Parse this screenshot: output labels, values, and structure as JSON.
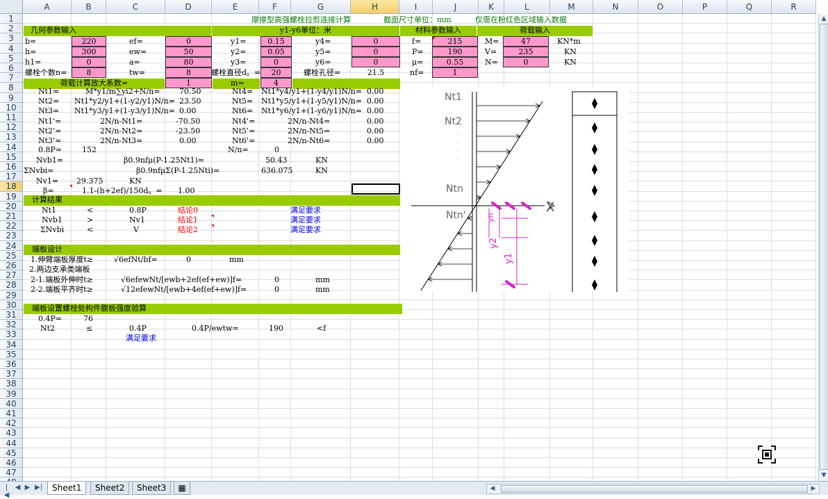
{
  "columns": [
    "A",
    "B",
    "C",
    "D",
    "E",
    "F",
    "G",
    "H",
    "I",
    "J",
    "K",
    "L",
    "M",
    "N",
    "O",
    "P",
    "Q",
    "R"
  ],
  "selected_column": "H",
  "selected_row": 18,
  "rows": 48,
  "title_row": {
    "title": "摩擦型高强螺栓拉剪连接计算",
    "unit": "截面尺寸单位：mm",
    "hint": "仅需在粉红色区域输入数据"
  },
  "headers": {
    "geom": "几何参数输入",
    "y_units": "y1-y6单位：米",
    "material": "材料参数输入",
    "load": "荷载输入",
    "amp": "荷载计算放大系数=",
    "result": "计算结果",
    "endplate": "端板设计",
    "web": "端板设置螺栓处构件腹板强度验算"
  },
  "geom": {
    "b_lbl": "b=",
    "b": "220",
    "h_lbl": "h=",
    "h": "300",
    "h1_lbl": "h1=",
    "h1": "0",
    "n_lbl": "螺栓个数n=",
    "n": "8",
    "ef_lbl": "ef=",
    "ef": "0",
    "ew_lbl": "ew=",
    "ew": "50",
    "a_lbl": "a=",
    "a": "80",
    "tw_lbl": "tw=",
    "tw": "8",
    "y1_lbl": "y1=",
    "y1": "0.15",
    "y2_lbl": "y2=",
    "y2": "0.05",
    "y3_lbl": "y3=",
    "y3": "0",
    "d0_lbl": "螺栓直径d。=",
    "d0": "20",
    "y4_lbl": "y4=",
    "y4": "0",
    "y5_lbl": "y5=",
    "y5": "0",
    "y6_lbl": "y6=",
    "y6": "0",
    "hole_lbl": "螺栓孔径=",
    "hole": "21.5"
  },
  "material": {
    "f_lbl": "f=",
    "f": "215",
    "P_lbl": "P=",
    "P": "190",
    "mu_lbl": "μ=",
    "mu": "0.55",
    "nf_lbl": "nf=",
    "nf": "1"
  },
  "load": {
    "M_lbl": "M=",
    "M": "47",
    "M_unit": "KN*m",
    "V_lbl": "V=",
    "V": "235",
    "V_unit": "KN",
    "N_lbl": "N=",
    "N": "0",
    "N_unit": "KN"
  },
  "amp": {
    "value": "1",
    "m_lbl": "m=",
    "m": "4"
  },
  "calc": [
    {
      "a": "Nt1=",
      "c": "M*y1/m∑yi2+N/n=",
      "d": "70.50",
      "e": "Nt4=",
      "f": "Nt1*y4/y1+(1-y4/y1)N/n=",
      "h": "0.00"
    },
    {
      "a": "Nt2=",
      "c": "Nt1*y2/y1+(1-y2/y1)N/n=",
      "d": "23.50",
      "e": "Nt5=",
      "f": "Nt1*y5/y1+(1-y5/y1)N/n=",
      "h": "0.00"
    },
    {
      "a": "Nt3=",
      "c": "Nt1*y3/y1+(1-y3/y1)N/n=",
      "d": "0.00",
      "e": "Nt6=",
      "f": "Nt1*y6/y1+(1-y6/y1)N/n=",
      "h": "0.00"
    },
    {
      "a": "Nt1'=",
      "c": "2N/n-Nt1=",
      "d": "-70.50",
      "e": "Nt4'=",
      "f": "2N/n-Nt4=",
      "h": "0.00"
    },
    {
      "a": "Nt2'=",
      "c": "2N/n-Nt2=",
      "d": "-23.50",
      "e": "Nt5'=",
      "f": "2N/n-Nt5=",
      "h": "0.00"
    },
    {
      "a": "Nt3'=",
      "c": "2N/n-Nt3=",
      "d": "0.00",
      "e": "Nt6'=",
      "f": "2N/n-Nt6=",
      "h": "0.00"
    }
  ],
  "r14": {
    "a": "0.8P=",
    "b": "152",
    "e": "N/n=",
    "f": "0"
  },
  "r15": {
    "a": "Nvb1=",
    "c": "β0.9nfμ(P-1.25Nt1)=",
    "f": "50.43",
    "g": "KN"
  },
  "r16": {
    "a": "ΣNvbi=",
    "c": "β0.9nfμΣ(P-1.25Nti)=",
    "f": "636.075",
    "g": "KN"
  },
  "r17": {
    "a": "Nv1=",
    "b": "29.375",
    "c": "KN"
  },
  "r18": {
    "a": "β=",
    "c": "1.1-(h+2ef)/150d。=",
    "d": "1.00"
  },
  "results": [
    {
      "a": "Nt1",
      "b": "<",
      "c": "0.8P",
      "d": "结论0",
      "g": "满足要求"
    },
    {
      "a": "Nvb1",
      "b": ">",
      "c": "Nv1",
      "d": "结论1",
      "g": "满足要求"
    },
    {
      "a": "ΣNvbi",
      "b": "<",
      "c": "V",
      "d": "结论2",
      "g": "满足要求"
    }
  ],
  "endplate": {
    "r25a": "1.伸臂端板厚度t≥",
    "r25c": "√6efNt/bf=",
    "r25d": "0",
    "r25e": "mm",
    "r26a": "2.两边支承类端板",
    "r27a": "2-1.端板外伸时t≥",
    "r27c": "√6efewNt/[ewb+2ef(ef+ew)]f=",
    "r27f": "0",
    "r27g": "mm",
    "r28a": "2-2.端板平齐时t≥",
    "r28c": "√12efewNt/[ewb+4ef(ef+ew)]f=",
    "r28f": "0",
    "r28g": "mm"
  },
  "web": {
    "r31a": "0.4P=",
    "r31b": "76",
    "r32a": "Nt2",
    "r32b": "≤",
    "r32c": "0.4P",
    "r32d": "0.4P/ewtw=",
    "r32f": "190",
    "r32g": "<f",
    "r33c": "满足要求"
  },
  "diagram": {
    "labels": [
      "Nt1",
      "Nt2",
      "Ntn",
      "Ntn'",
      "X",
      "y1",
      "y2",
      "yn"
    ]
  },
  "tabs": [
    "Sheet1",
    "Sheet2",
    "Sheet3"
  ],
  "active_tab": "Sheet1",
  "colors": {
    "pink": "#ff99cc",
    "green": "#99cc00",
    "magenta": "#d426c8"
  }
}
